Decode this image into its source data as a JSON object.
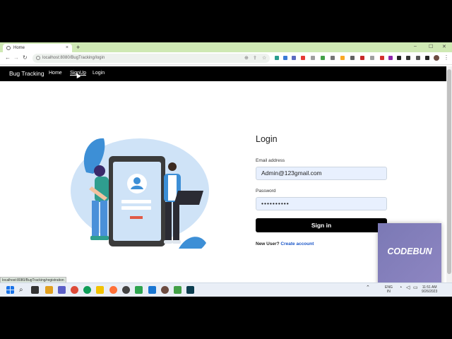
{
  "browser": {
    "tab_title": "Home",
    "new_tab": "+",
    "url": "localhost:8080/BugTracking/login",
    "status_url": "localhost:8080/BugTracking/registration",
    "controls": {
      "minimize": "–",
      "maximize": "☐",
      "close": "✕"
    },
    "nav": {
      "back": "←",
      "forward": "→",
      "reload": "↻"
    }
  },
  "navbar": {
    "brand": "Bug Tracking",
    "links": [
      "Home",
      "SignUp",
      "Login"
    ]
  },
  "login": {
    "title": "Login",
    "email_label": "Email address",
    "email_value": "Admin@123gmail.com",
    "password_label": "Password",
    "password_value": "••••••••••",
    "signin_label": "Sign in",
    "new_user_text": "New User?",
    "create_account": "Create account"
  },
  "watermark": "CODEBUN",
  "taskbar": {
    "lang_top": "ENG",
    "lang_bottom": "IN",
    "time": "11:51 AM",
    "date": "9/26/2023"
  },
  "colors": {
    "navbar_bg": "#000000",
    "tab_strip": "#cfe9b4",
    "input_bg": "#e8f0fe",
    "link_blue": "#1a56c8",
    "illustration_blob": "#cfe3f7",
    "illustration_accent": "#3d8fd6",
    "codebun_bg": "#8582bd"
  }
}
